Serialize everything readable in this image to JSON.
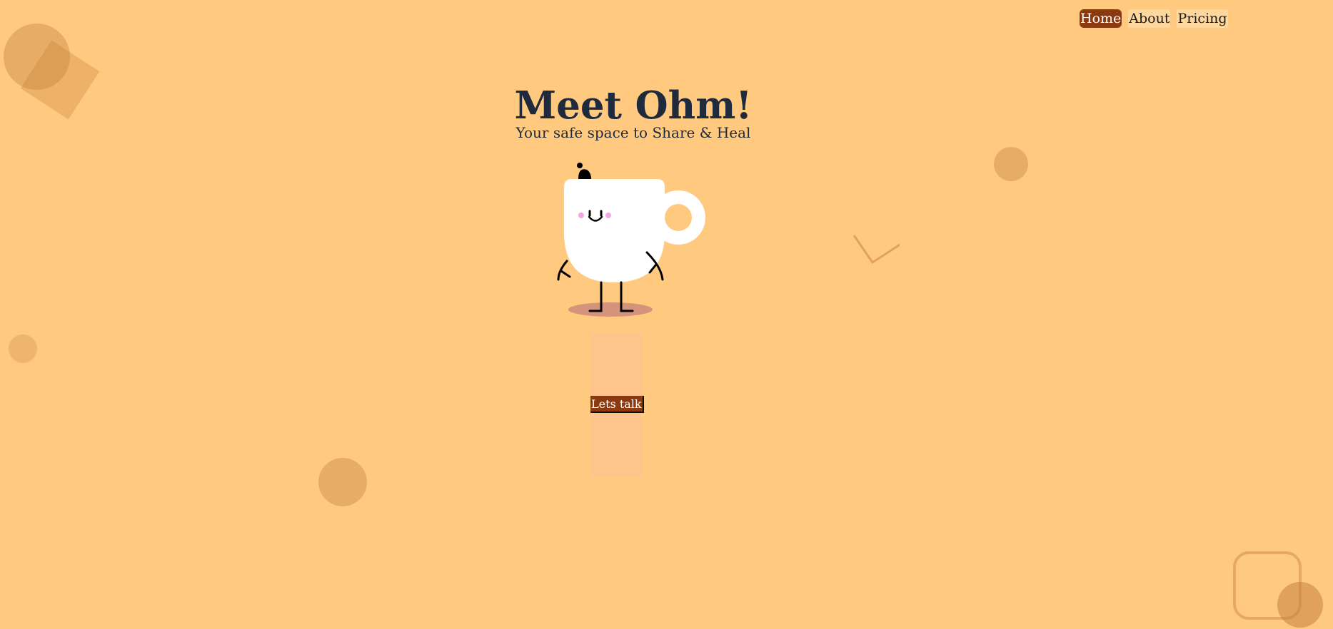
{
  "nav": {
    "items": [
      {
        "label": "Home",
        "active": true
      },
      {
        "label": "About",
        "active": false
      },
      {
        "label": "Pricing",
        "active": false
      }
    ]
  },
  "hero": {
    "title": "Meet Ohm!",
    "subtitle": "Your safe space to Share & Heal"
  },
  "cta": {
    "label": "Lets talk"
  },
  "colors": {
    "background": "#ffca80",
    "accent": "#8b3a0f",
    "text": "#1f2a3c",
    "mascot_body": "#ffffff",
    "decoration": "#d99d5c"
  },
  "icons": {
    "mascot": "smiling-coffee-cup-mascot"
  }
}
